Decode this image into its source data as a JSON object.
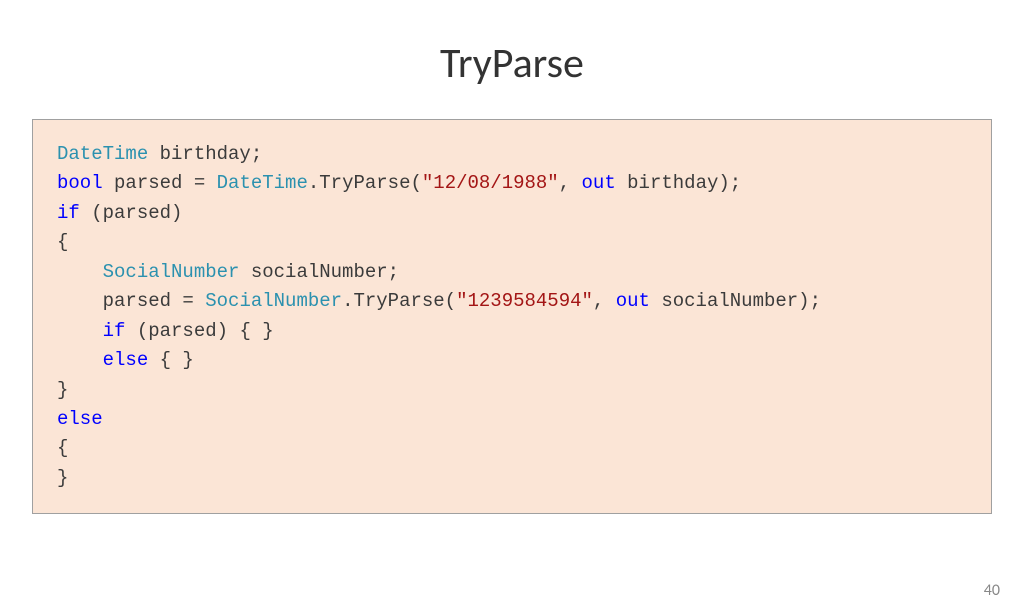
{
  "slide": {
    "title": "TryParse",
    "page_number": "40"
  },
  "code": {
    "t_datetime": "DateTime",
    "sp1": " birthday;",
    "sp2": " parsed = ",
    "t_bool": "bool",
    "m_tryparse1": ".TryParse(",
    "str_date": "\"12/08/1988\"",
    "comma_sp": ", ",
    "kw_out": "out",
    "sp3": " birthday);",
    "kw_if": "if",
    "sp4": " (parsed)",
    "brace_open": "{",
    "t_socialnumber": "SocialNumber",
    "sp5": " socialNumber;",
    "sp6": "    parsed = ",
    "str_num": "\"1239584594\"",
    "sp7": " socialNumber);",
    "sp8": " (parsed) { }",
    "kw_else": "else",
    "sp9": " { }",
    "brace_close": "}",
    "indent4": "    "
  }
}
